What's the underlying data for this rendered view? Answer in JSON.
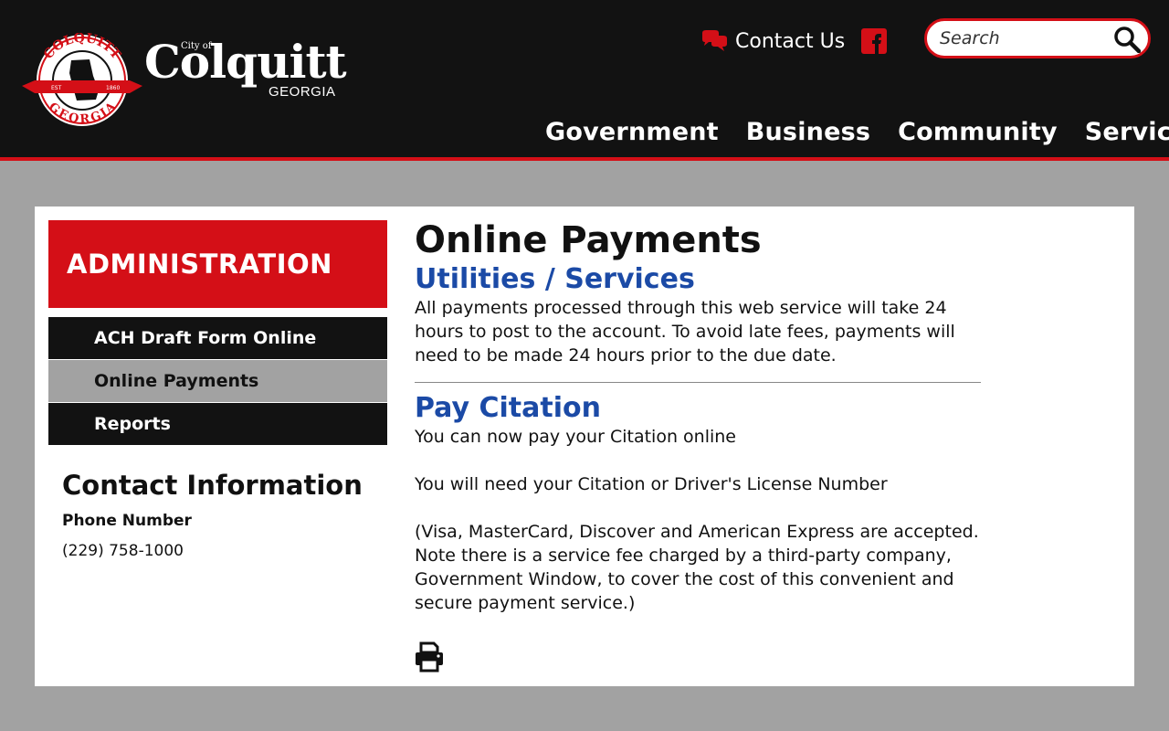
{
  "header": {
    "seal_top_text": "COLQUITT",
    "seal_bottom_text": "GEORGIA",
    "seal_left_text": "EST",
    "seal_right_text": "1860",
    "brand_city_of": "City of",
    "brand_name": "Colquitt",
    "brand_state": "GEORGIA",
    "contact_label": "Contact Us",
    "search_placeholder": "Search"
  },
  "nav": {
    "items": [
      "Government",
      "Business",
      "Community",
      "Services"
    ]
  },
  "sidebar": {
    "title": "ADMINISTRATION",
    "items": [
      {
        "label": "ACH Draft Form Online",
        "active": false
      },
      {
        "label": "Online Payments",
        "active": true
      },
      {
        "label": "Reports",
        "active": false
      }
    ]
  },
  "contact": {
    "heading": "Contact Information",
    "phone_label": "Phone Number",
    "phone_value": "(229) 758-1000"
  },
  "main": {
    "title": "Online Payments",
    "utilities_heading": "Utilities / Services",
    "utilities_text": "All payments processed through this web service will take 24 hours to post to the account. To avoid late fees, payments will need to be made 24 hours prior to the due date.",
    "citation_heading": "Pay Citation",
    "citation_line1": "You can now pay your Citation online",
    "citation_line2": "You will need your Citation or Driver's License Number",
    "citation_line3": "(Visa, MasterCard, Discover and American Express are accepted. Note there is a service fee charged by a third-party company, Government Window, to cover the cost of this convenient and secure payment service.)"
  },
  "colors": {
    "header_bg": "#121212",
    "brand_red": "#d40f17",
    "page_bg": "#a2a2a2",
    "link_blue": "#1b4aa6"
  }
}
